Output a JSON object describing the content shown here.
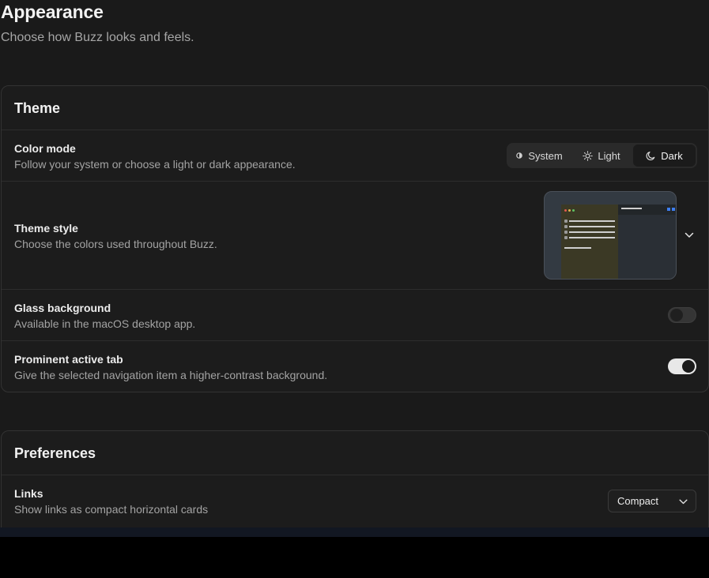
{
  "header": {
    "title": "Appearance",
    "subtitle": "Choose how Buzz looks and feels."
  },
  "theme": {
    "heading": "Theme",
    "color_mode": {
      "title": "Color mode",
      "description": "Follow your system or choose a light or dark appearance.",
      "options": [
        "System",
        "Light",
        "Dark"
      ],
      "selected": "Dark"
    },
    "theme_style": {
      "title": "Theme style",
      "description": "Choose the colors used throughout Buzz."
    },
    "glass_background": {
      "title": "Glass background",
      "description": "Available in the macOS desktop app.",
      "enabled": false
    },
    "prominent_active_tab": {
      "title": "Prominent active tab",
      "description": "Give the selected navigation item a higher-contrast background.",
      "enabled": true
    }
  },
  "preferences": {
    "heading": "Preferences",
    "links": {
      "title": "Links",
      "description": "Show links as compact horizontal cards",
      "value": "Compact"
    }
  },
  "colors": {
    "background": "#1a1a1a",
    "card": "#1c1c1c",
    "border": "#333333",
    "accent_blue": "#3d7ef0"
  },
  "icons": {
    "system": "system-icon",
    "light": "sun-icon",
    "dark": "moon-icon",
    "dropdown": "chevron-down-icon"
  }
}
